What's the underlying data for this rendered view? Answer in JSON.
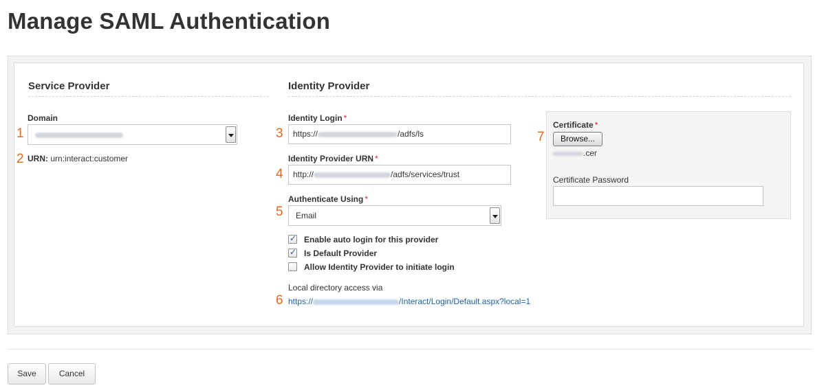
{
  "page": {
    "title": "Manage SAML Authentication"
  },
  "service_provider": {
    "title": "Service Provider",
    "domain_label": "Domain",
    "urn_label": "URN:",
    "urn_value": "urn:interact:customer"
  },
  "identity_provider": {
    "title": "Identity Provider",
    "identity_login": {
      "label": "Identity Login",
      "required_mark": "*",
      "value_prefix": "https://",
      "value_suffix": "/adfs/ls"
    },
    "provider_urn": {
      "label": "Identity Provider URN",
      "required_mark": "*",
      "value_prefix": "http://",
      "value_suffix": "/adfs/services/trust"
    },
    "authenticate_using": {
      "label": "Authenticate Using",
      "required_mark": "*",
      "selected": "Email"
    },
    "checkboxes": [
      {
        "label": "Enable auto login for this provider",
        "checked": true
      },
      {
        "label": "Is Default Provider",
        "checked": true
      },
      {
        "label": "Allow Identity Provider to initiate login",
        "checked": false
      }
    ],
    "local_access_label": "Local directory access via",
    "local_access_link_prefix": "https://",
    "local_access_link_suffix": "/Interact/Login/Default.aspx?local=1"
  },
  "certificate": {
    "label": "Certificate",
    "required_mark": "*",
    "browse_label": "Browse...",
    "file_suffix": ".cer",
    "password_label": "Certificate Password",
    "password_value": ""
  },
  "annotations": [
    "1",
    "2",
    "3",
    "4",
    "5",
    "6",
    "7"
  ],
  "buttons": {
    "save": "Save",
    "cancel": "Cancel"
  },
  "colors": {
    "annotation": "#e06a22",
    "link": "#1f5fa6",
    "required": "#cc2222"
  }
}
